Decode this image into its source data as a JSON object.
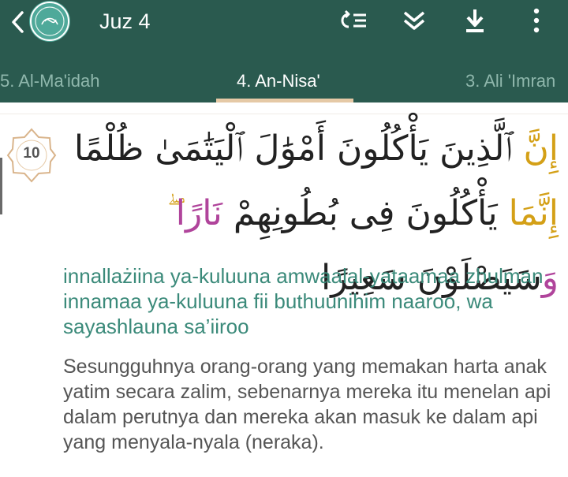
{
  "header": {
    "title": "Juz 4",
    "icons": [
      "back-arrow-icon",
      "quran-logo-icon",
      "repeat-list-icon",
      "double-chevron-down-icon",
      "download-icon",
      "more-vertical-icon"
    ]
  },
  "tabs": [
    {
      "label": "5. Al-Ma'idah",
      "active": false
    },
    {
      "label": "4. An-Nisa'",
      "active": true
    },
    {
      "label": "3. Ali 'Imran",
      "active": false
    }
  ],
  "verse": {
    "number": "10",
    "arabic_part1": "إِنَّ",
    "arabic_part2": " ٱلَّذِينَ يَأْكُلُونَ أَمْوَٰلَ ٱلْيَتَٰمَىٰ ظُلْمًا ",
    "arabic_part3": "إِنَّمَا",
    "arabic_part4": " يَأْكُلُونَ فِى بُطُونِهِمْ ",
    "arabic_part5": "نَارًا",
    "arabic_part6": " ۖ ",
    "arabic_part7": "وَ",
    "arabic_part8": "سَيَصْلَوْنَ سَعِيرًا",
    "transliteration": "innallażiina ya-kuluuna amwaalal-yataamaa zhulman innamaa ya-kuluuna fii buthuunihim naaroo, wa sayashlauna sa’iiroo",
    "translation": "Sesungguhnya orang-orang yang memakan harta anak yatim secara zalim, sebenarnya mereka itu menelan api dalam perutnya dan mereka akan masuk ke dalam api yang menyala-nyala (neraka)."
  },
  "colors": {
    "header_bg": "#2a5a4f",
    "tab_indicator": "#e5c9a6",
    "transliteration": "#3b8a7a",
    "translation": "#555555",
    "tajwid_gold": "#d4a017",
    "tajwid_purple": "#b0449b"
  }
}
